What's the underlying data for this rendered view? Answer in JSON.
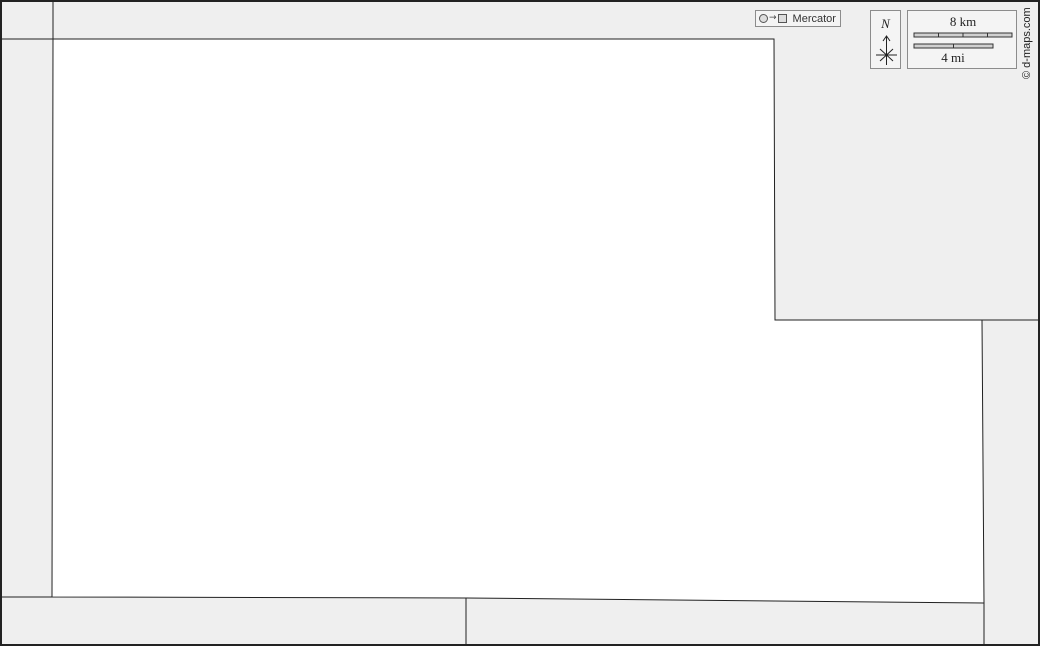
{
  "map": {
    "projection": {
      "label": "Mercator"
    },
    "north_arrow": {
      "label": "N"
    },
    "scale_bar": {
      "metric_label": "8 km",
      "imperial_label": "4 mi"
    },
    "credit": "© d-maps.com",
    "colors": {
      "selected_area": "#ffffff",
      "surrounding_area": "#efefef",
      "border": "#222222"
    }
  }
}
